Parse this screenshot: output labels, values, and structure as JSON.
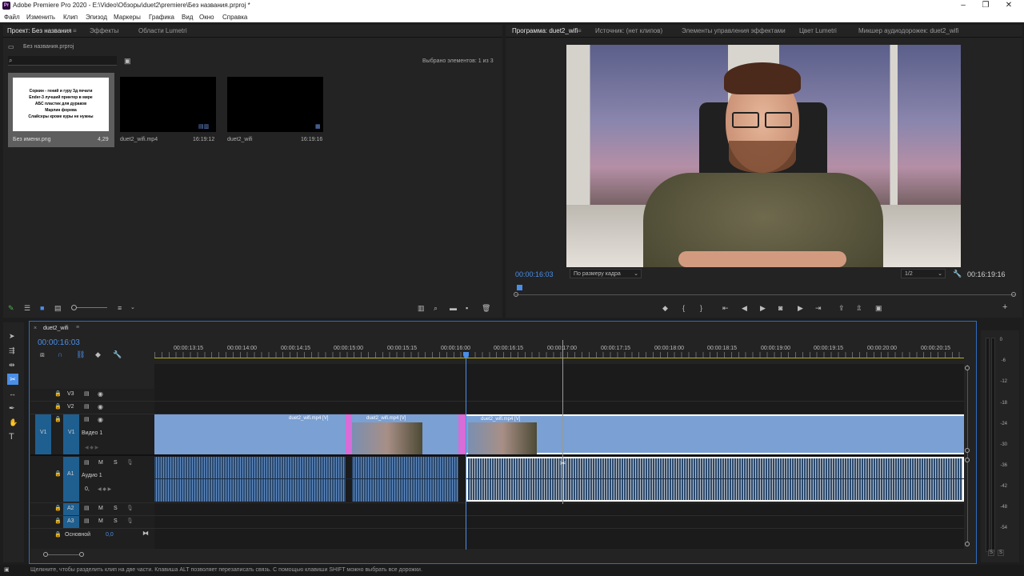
{
  "titlebar": {
    "title": "Adobe Premiere Pro 2020 - E:\\Video\\Обзоры\\duet2\\premiere\\Без названия.prproj *",
    "logo": "Pr"
  },
  "menu": [
    "Файл",
    "Изменить",
    "Клип",
    "Эпизод",
    "Маркеры",
    "Графика",
    "Вид",
    "Окно",
    "Справка"
  ],
  "project": {
    "tabs": [
      "Проект: Без названия",
      "Эффекты",
      "Области Lumetri"
    ],
    "path": "Без названия.prproj",
    "selected": "Выбрано элементов: 1 из 3",
    "items": [
      {
        "name": "Без имени.png",
        "dur": "4,29",
        "text": [
          "Соркин - гений и гуру 3д печати",
          "Ender-3 лучший принтер в мире",
          "АБС пластик для дураков",
          "Марлин форева",
          "Слайсеры кроме куры не нужны"
        ]
      },
      {
        "name": "duet2_wifi.mp4",
        "dur": "16:19:12"
      },
      {
        "name": "duet2_wifi",
        "dur": "16:19:16"
      }
    ]
  },
  "program": {
    "tabs": [
      "Программа: duet2_wifi",
      "Источник: (нет клипов)",
      "Элементы управления эффектами",
      "Цвет Lumetri",
      "Микшер аудиодорожек: duet2_wifi"
    ],
    "timecode": "00:00:16:03",
    "fit": "По размеру кадра",
    "resolution": "1/2",
    "duration": "00:16:19:16"
  },
  "timeline": {
    "tab": "duet2_wifi",
    "timecode": "00:00:16:03",
    "ruler": [
      "00:00:13:15",
      "00:00:14:00",
      "00:00:14:15",
      "00:00:15:00",
      "00:00:15:15",
      "00:00:16:00",
      "00:00:16:15",
      "00:00:17:00",
      "00:00:17:15",
      "00:00:18:00",
      "00:00:18:15",
      "00:00:19:00",
      "00:00:19:15",
      "00:00:20:00",
      "00:00:20:15"
    ],
    "tracks": {
      "v3": "V3",
      "v2": "V2",
      "v1": "V1",
      "v1src": "V1",
      "v1name": "Видео 1",
      "a1": "A1",
      "a1name": "Аудио 1",
      "a2": "A2",
      "a3": "A3",
      "master": "Основной",
      "master_val": "0,0",
      "m": "M",
      "s": "S",
      "zero": "0,"
    },
    "clips": [
      "duet2_wifi.mp4 [V]",
      "duet2_wifi.mp4 [V]",
      "duet2_wifi.mp4 [V]"
    ]
  },
  "meter": [
    "0",
    "-6",
    "-12",
    "-18",
    "-24",
    "-30",
    "-36",
    "-42",
    "-48",
    "-54"
  ],
  "meter_solo": [
    "S",
    "S"
  ],
  "status": "Щелкните, чтобы разделить клип на две части. Клавиша ALT позволяет перезаписать связь. С помощью клавиши SHIFT можно выбрать все дорожки."
}
